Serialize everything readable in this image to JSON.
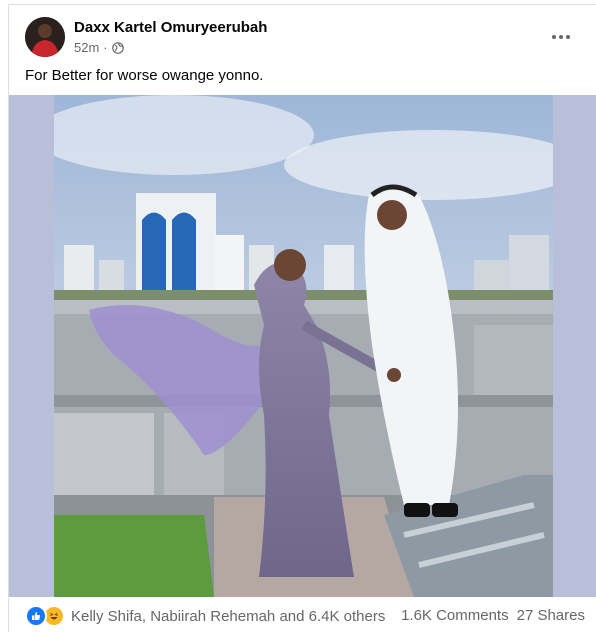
{
  "post": {
    "author": "Daxx Kartel Omuryeerubah",
    "time": "52m",
    "separator": "·",
    "privacy_icon": "globe-icon",
    "more_icon": "more-horizontal-icon",
    "caption": "For Better for worse owange yonno."
  },
  "reactions": {
    "icons": [
      "like-icon",
      "haha-icon"
    ],
    "summary": "Kelly Shifa, Nabiirah Rehemah and 6.4K others",
    "comments": "1.6K Comments",
    "shares": "27 Shares"
  },
  "colors": {
    "like": "#1877f2",
    "haha": "#f7b928",
    "secondary_text": "#65676b",
    "photo_frame": "#b9bfd9"
  }
}
